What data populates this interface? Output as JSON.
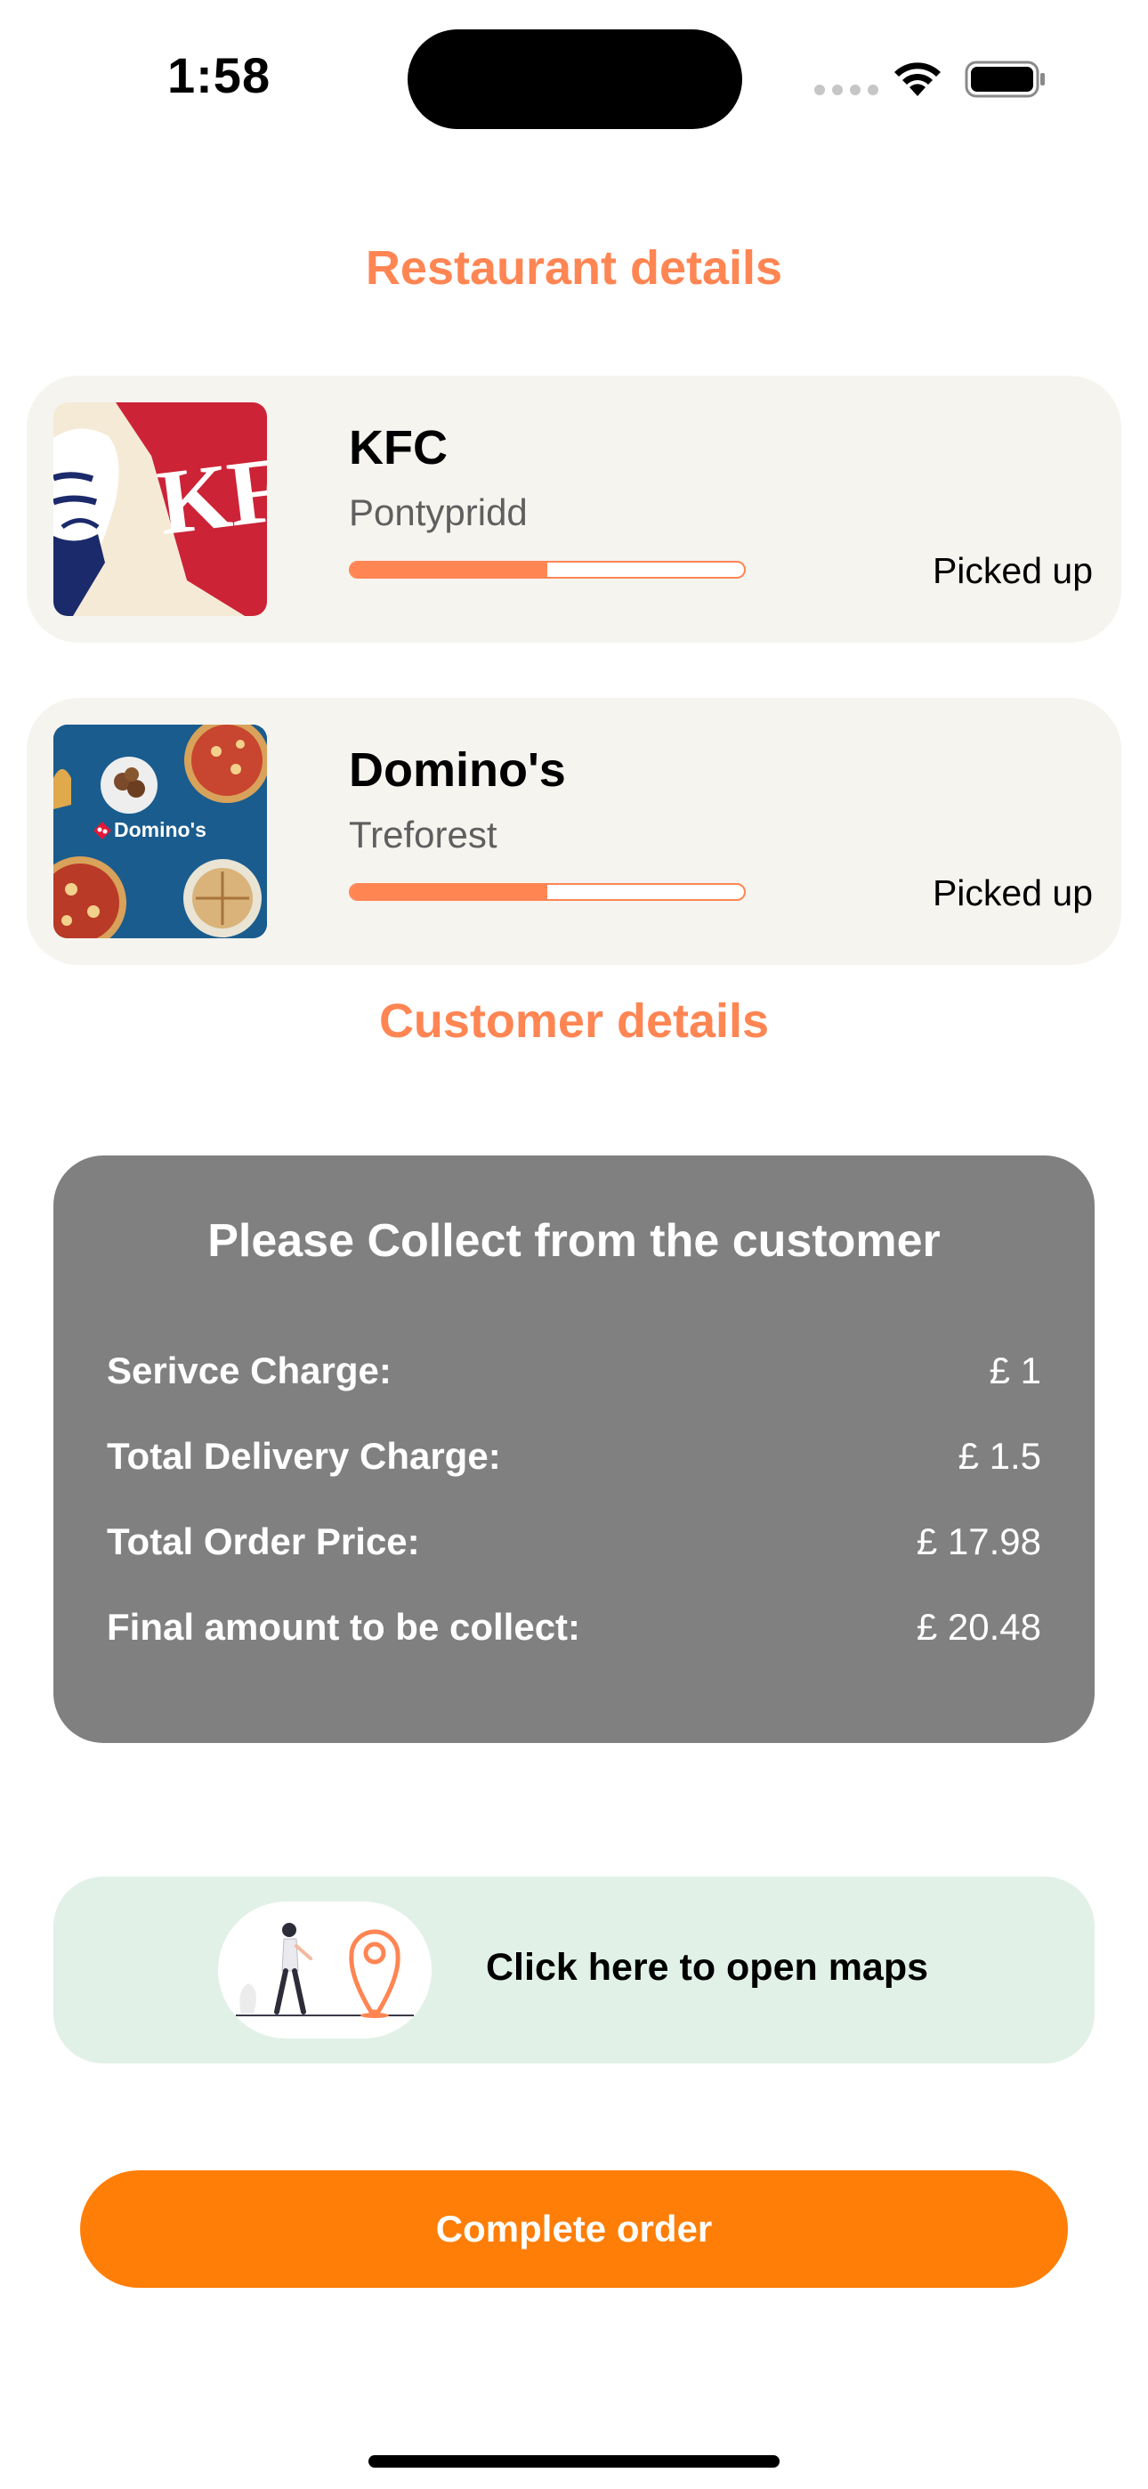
{
  "status_bar": {
    "time": "1:58"
  },
  "restaurant_section": {
    "title": "Restaurant details"
  },
  "restaurants": [
    {
      "name": "KFC",
      "area": "Pontypridd",
      "status": "Picked up",
      "progress": 0.5,
      "logo_text": "KF"
    },
    {
      "name": "Domino's",
      "area": "Treforest",
      "status": "Picked up",
      "progress": 0.5,
      "logo_text": "Domino's"
    }
  ],
  "customer_section": {
    "title": "Customer details"
  },
  "collect": {
    "title": "Please Collect from the customer",
    "rows": [
      {
        "label": "Serivce Charge:",
        "value": "£ 1"
      },
      {
        "label": "Total Delivery Charge:",
        "value": "£ 1.5"
      },
      {
        "label": "Total Order Price:",
        "value": "£ 17.98"
      },
      {
        "label": "Final amount to be collect:",
        "value": "£ 20.48"
      }
    ]
  },
  "maps": {
    "label": "Click here to open maps"
  },
  "complete_button": {
    "label": "Complete order"
  },
  "colors": {
    "accent": "#ff8553",
    "button": "#ff7e07",
    "card_bg": "#f6f4ef",
    "collect_bg": "#808080",
    "maps_bg": "#e1f1e8"
  }
}
